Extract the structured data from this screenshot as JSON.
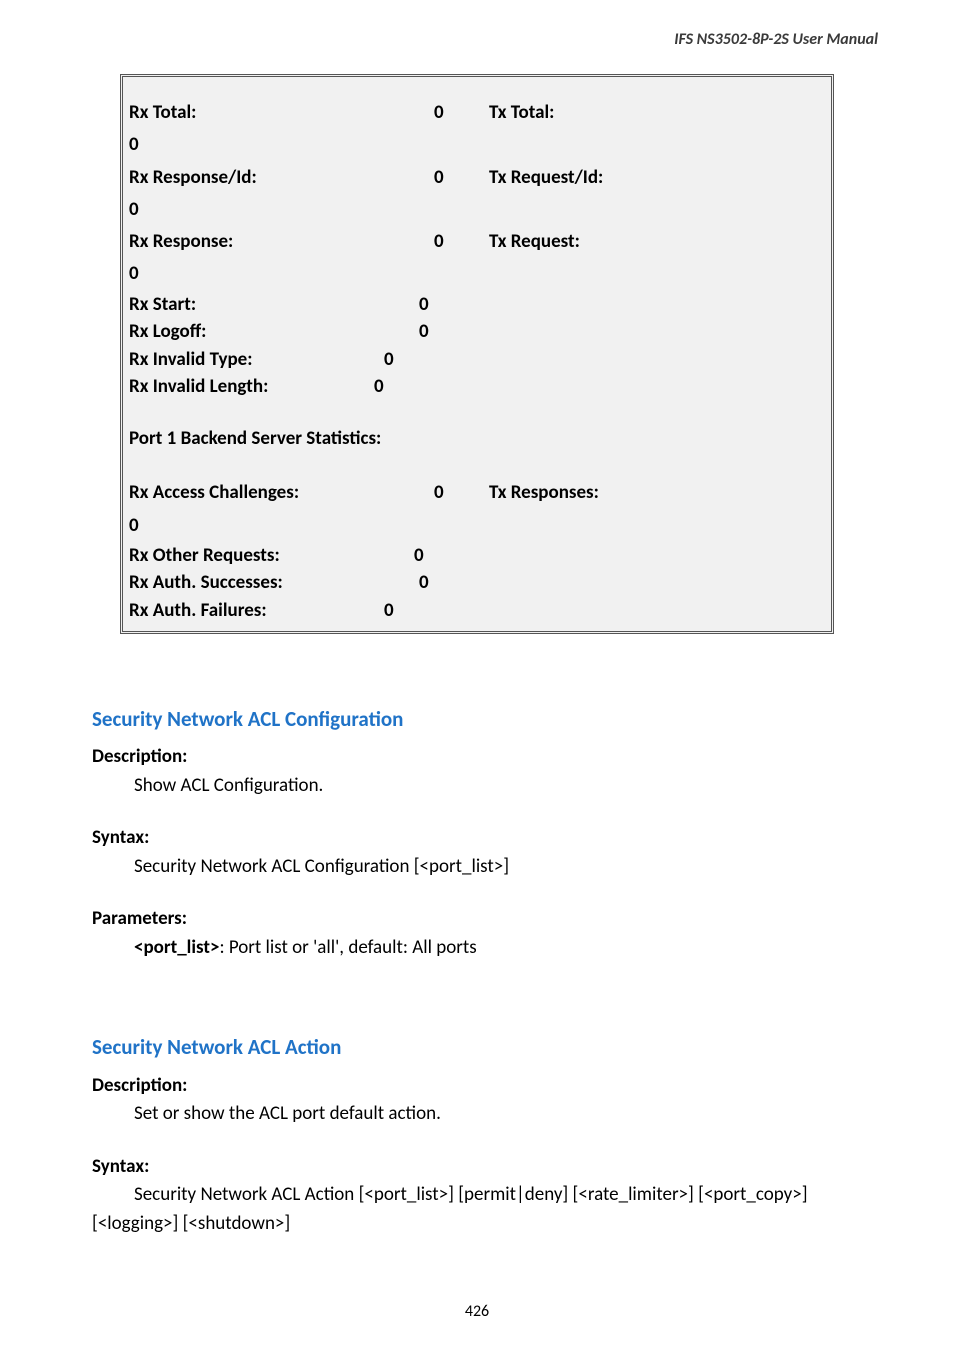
{
  "header": "IFS  NS3502-8P-2S  User  Manual",
  "stats": {
    "rxTotal": {
      "label": "Rx Total:",
      "value": "0"
    },
    "txTotal": {
      "label": "Tx Total:"
    },
    "zero1": "0",
    "rxRespId": {
      "label": "Rx Response/Id:",
      "value": "0"
    },
    "txReqId": {
      "label": "Tx Request/Id:"
    },
    "zero2": "0",
    "rxResp": {
      "label": "Rx Response:",
      "value": "0"
    },
    "txReq": {
      "label": "Tx Request:"
    },
    "zero3": "0",
    "rxStart": {
      "label": "Rx Start:",
      "value": "0"
    },
    "rxLogoff": {
      "label": "Rx Logoff:",
      "value": "0"
    },
    "rxInvType": {
      "label": "Rx Invalid Type:",
      "value": "0"
    },
    "rxInvLen": {
      "label": "Rx Invalid Length:",
      "value": "0"
    },
    "backendTitle": "Port 1 Backend Server Statistics:",
    "rxAccCh": {
      "label": "Rx Access Challenges:",
      "value": "0"
    },
    "txResps": {
      "label": "Tx Responses:"
    },
    "zero4": "0",
    "rxOther": {
      "label": "Rx Other Requests:",
      "value": "0"
    },
    "rxSucc": {
      "label": "Rx Auth. Successes:",
      "value": "0"
    },
    "rxFail": {
      "label": "Rx Auth. Failures:",
      "value": "0"
    }
  },
  "sec1": {
    "title": "Security Network ACL Configuration",
    "descLabel": "Description:",
    "desc": "Show ACL Configuration.",
    "syntaxLabel": "Syntax:",
    "syntax": "Security Network ACL Configuration [<port_list>]",
    "paramsLabel": "Parameters:",
    "paramKey": "<port_list>",
    "paramText": ": Port list or 'all', default: All ports"
  },
  "sec2": {
    "title": "Security Network ACL Action",
    "descLabel": "Description:",
    "desc": "Set or show the ACL port default action.",
    "syntaxLabel": "Syntax:",
    "syntax1": "Security Network ACL Action [<port_list>] [permit|deny] [<rate_limiter>] [<port_copy>]",
    "syntax2": "[<logging>] [<shutdown>]"
  },
  "pageNum": "426"
}
